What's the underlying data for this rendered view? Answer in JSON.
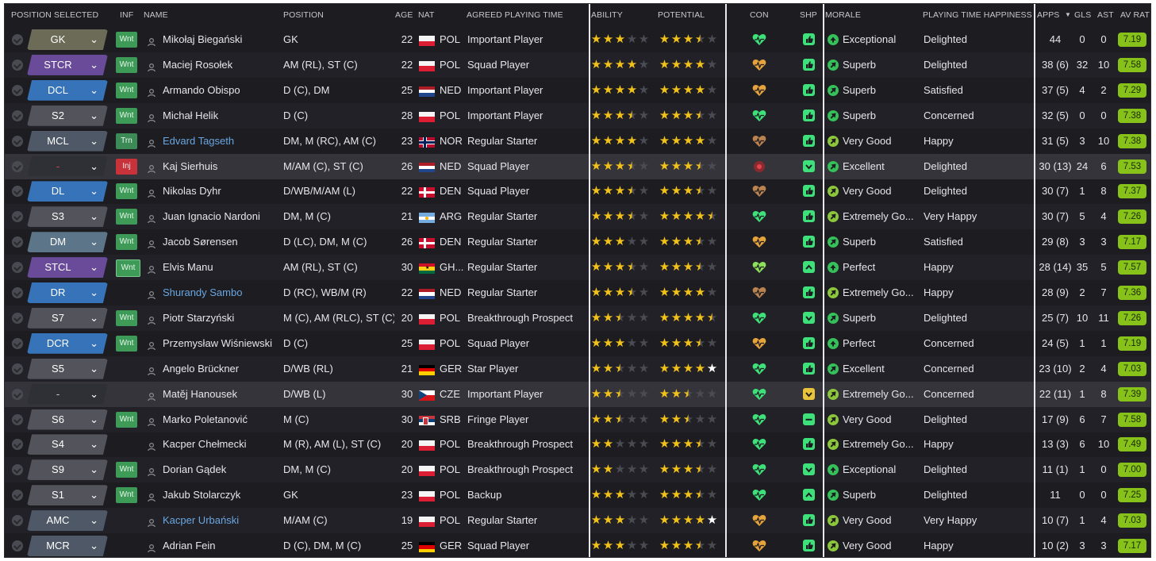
{
  "headers": {
    "position_selected": "POSITION SELECTED",
    "inf": "INF",
    "name": "NAME",
    "position": "POSITION",
    "age": "AGE",
    "nat": "NAT",
    "agreed_playing_time": "AGREED PLAYING TIME",
    "ability": "ABILITY",
    "potential": "POTENTIAL",
    "con": "CON",
    "shp": "SHP",
    "morale": "MORALE",
    "playing_time_happiness": "PLAYING TIME HAPPINESS",
    "apps": "APPS",
    "gls": "GLS",
    "ast": "AST",
    "av_rat": "AV RAT",
    "sort_indicator": "▼"
  },
  "colors": {
    "star_full": "#f2c21a",
    "star_empty": "#4b4b53",
    "rating_bg": "#86c219",
    "con_green": "#3ee07a",
    "con_orange": "#e6a33c",
    "shp_green": "#3ee07a",
    "shp_yellow": "#e8c23a",
    "wanted_badge": "#3d9a57",
    "injured_badge": "#c8333b"
  },
  "players": [
    {
      "sel": "GK",
      "selstyle": "gk",
      "inf": "Wnt",
      "name": "Mikołaj Biegański",
      "link": false,
      "position": "GK",
      "age": "22",
      "nat": "POL",
      "flag": "pol",
      "apt": "Important Player",
      "ability": 3,
      "potential": 3.5,
      "con": "green",
      "shp": "thumb-green",
      "morale": "Exceptional",
      "mdir": "up",
      "mcolor": "#35c05a",
      "pth": "Delighted",
      "apps": "44",
      "gls": "0",
      "ast": "0",
      "rat": "7.19"
    },
    {
      "sel": "STCR",
      "selstyle": "str",
      "inf": "Wnt",
      "name": "Maciej Rosołek",
      "link": false,
      "position": "AM (RL), ST (C)",
      "age": "22",
      "nat": "POL",
      "flag": "pol",
      "apt": "Squad Player",
      "ability": 4,
      "potential": 4,
      "con": "orange",
      "shp": "thumb-green",
      "morale": "Superb",
      "mdir": "up-right",
      "mcolor": "#35c05a",
      "pth": "Delighted",
      "apps": "38 (6)",
      "gls": "32",
      "ast": "10",
      "rat": "7.58"
    },
    {
      "sel": "DCL",
      "selstyle": "def",
      "inf": "Wnt",
      "name": "Armando Obispo",
      "link": false,
      "position": "D (C), DM",
      "age": "25",
      "nat": "NED",
      "flag": "ned",
      "apt": "Important Player",
      "ability": 4,
      "potential": 4,
      "con": "orange",
      "shp": "thumb-green",
      "morale": "Superb",
      "mdir": "up-right",
      "mcolor": "#35c05a",
      "pth": "Satisfied",
      "apps": "37 (5)",
      "gls": "4",
      "ast": "2",
      "rat": "7.29"
    },
    {
      "sel": "S2",
      "selstyle": "sub",
      "inf": "Wnt",
      "name": "Michał Helik",
      "link": false,
      "position": "D (C)",
      "age": "28",
      "nat": "POL",
      "flag": "pol",
      "apt": "Important Player",
      "ability": 3.5,
      "potential": 3.5,
      "con": "green",
      "shp": "thumb-green",
      "morale": "Superb",
      "mdir": "up-right",
      "mcolor": "#35c05a",
      "pth": "Concerned",
      "apps": "32 (5)",
      "gls": "0",
      "ast": "0",
      "rat": "7.38"
    },
    {
      "sel": "MCL",
      "selstyle": "mid",
      "inf": "Trn",
      "name": "Edvard Tagseth",
      "link": true,
      "position": "DM, M (RC), AM (C)",
      "age": "23",
      "nat": "NOR",
      "flag": "nor",
      "apt": "Regular Starter",
      "ability": 4,
      "potential": 4,
      "con": "brown",
      "shp": "thumb-green",
      "morale": "Very Good",
      "mdir": "up-right",
      "mcolor": "#8cc63a",
      "pth": "Happy",
      "apps": "31 (5)",
      "gls": "3",
      "ast": "10",
      "rat": "7.38"
    },
    {
      "sel": "-",
      "selstyle": "none red",
      "inf": "Inj",
      "name": "Kaj Sierhuis",
      "link": false,
      "position": "M/AM (C), ST (C)",
      "age": "26",
      "nat": "NED",
      "flag": "ned",
      "apt": "Squad Player",
      "ability": 3.5,
      "potential": 3.5,
      "con": "injury",
      "shp": "chev-green",
      "morale": "Excellent",
      "mdir": "up-right",
      "mcolor": "#35c05a",
      "pth": "Delighted",
      "apps": "30 (13)",
      "gls": "24",
      "ast": "6",
      "rat": "7.53"
    },
    {
      "sel": "DL",
      "selstyle": "def",
      "inf": "Wnt",
      "name": "Nikolas Dyhr",
      "link": false,
      "position": "D/WB/M/AM (L)",
      "age": "22",
      "nat": "DEN",
      "flag": "den",
      "apt": "Squad Player",
      "ability": 3.5,
      "potential": 3.5,
      "con": "brown",
      "shp": "thumb-green",
      "morale": "Very Good",
      "mdir": "up-right",
      "mcolor": "#8cc63a",
      "pth": "Delighted",
      "apps": "30 (7)",
      "gls": "1",
      "ast": "8",
      "rat": "7.37"
    },
    {
      "sel": "S3",
      "selstyle": "sub",
      "inf": "Wnt",
      "name": "Juan Ignacio Nardoni",
      "link": false,
      "position": "DM, M (C)",
      "age": "21",
      "nat": "ARG",
      "flag": "arg",
      "apt": "Regular Starter",
      "ability": 3.5,
      "potential": 4.5,
      "con": "green",
      "shp": "thumb-green",
      "morale": "Extremely Go...",
      "mdir": "up-right",
      "mcolor": "#8cc63a",
      "pth": "Very Happy",
      "apps": "30 (7)",
      "gls": "5",
      "ast": "4",
      "rat": "7.26"
    },
    {
      "sel": "DM",
      "selstyle": "dm",
      "inf": "Wnt",
      "name": "Jacob Sørensen",
      "link": false,
      "position": "D (LC), DM, M (C)",
      "age": "26",
      "nat": "DEN",
      "flag": "den",
      "apt": "Regular Starter",
      "ability": 3,
      "potential": 3.5,
      "con": "orange",
      "shp": "thumb-green",
      "morale": "Superb",
      "mdir": "up-right",
      "mcolor": "#35c05a",
      "pth": "Satisfied",
      "apps": "29 (8)",
      "gls": "3",
      "ast": "3",
      "rat": "7.17"
    },
    {
      "sel": "STCL",
      "selstyle": "str",
      "inf": "Wnt",
      "name": "Elvis Manu",
      "link": false,
      "position": "AM (RL), ST (C)",
      "age": "30",
      "nat": "GH...",
      "flag": "gha",
      "apt": "Regular Starter",
      "ability": 3.5,
      "potential": 3.5,
      "con": "lime",
      "shp": "chev-up-green",
      "morale": "Perfect",
      "mdir": "up",
      "mcolor": "#35c05a",
      "pth": "Happy",
      "apps": "28 (14)",
      "gls": "35",
      "ast": "5",
      "rat": "7.57"
    },
    {
      "sel": "DR",
      "selstyle": "def",
      "inf": "",
      "name": "Shurandy Sambo",
      "link": true,
      "position": "D (RC), WB/M (R)",
      "age": "22",
      "nat": "NED",
      "flag": "ned",
      "apt": "Regular Starter",
      "ability": 3.5,
      "potential": 4,
      "con": "brown",
      "shp": "thumb-green",
      "morale": "Extremely Go...",
      "mdir": "up-right",
      "mcolor": "#8cc63a",
      "pth": "Happy",
      "apps": "28 (9)",
      "gls": "2",
      "ast": "7",
      "rat": "7.36"
    },
    {
      "sel": "S7",
      "selstyle": "sub",
      "inf": "Wnt",
      "name": "Piotr Starzyński",
      "link": false,
      "position": "M (C), AM (RLC), ST (C)",
      "age": "20",
      "nat": "POL",
      "flag": "pol",
      "apt": "Breakthrough Prospect",
      "ability": 2.5,
      "potential": 4.5,
      "con": "green",
      "shp": "chev-green",
      "morale": "Superb",
      "mdir": "up-right",
      "mcolor": "#35c05a",
      "pth": "Delighted",
      "apps": "25 (7)",
      "gls": "10",
      "ast": "11",
      "rat": "7.26"
    },
    {
      "sel": "DCR",
      "selstyle": "def",
      "inf": "Wnt",
      "name": "Przemysław Wiśniewski",
      "link": false,
      "position": "D (C)",
      "age": "25",
      "nat": "POL",
      "flag": "pol",
      "apt": "Squad Player",
      "ability": 3,
      "potential": 3.5,
      "con": "orange",
      "shp": "thumb-green",
      "morale": "Perfect",
      "mdir": "up",
      "mcolor": "#35c05a",
      "pth": "Concerned",
      "apps": "24 (5)",
      "gls": "1",
      "ast": "1",
      "rat": "7.19"
    },
    {
      "sel": "S5",
      "selstyle": "sub",
      "inf": "",
      "name": "Angelo Brückner",
      "link": false,
      "position": "D/WB (RL)",
      "age": "21",
      "nat": "GER",
      "flag": "ger",
      "apt": "Star Player",
      "ability": 2.5,
      "potential": 4,
      "potwhite": true,
      "con": "green",
      "shp": "thumb-green",
      "morale": "Excellent",
      "mdir": "up-right",
      "mcolor": "#35c05a",
      "pth": "Concerned",
      "apps": "23 (10)",
      "gls": "2",
      "ast": "4",
      "rat": "7.03"
    },
    {
      "sel": "-",
      "selstyle": "none",
      "inf": "",
      "name": "Matěj Hanousek",
      "link": false,
      "position": "D/WB (L)",
      "age": "30",
      "nat": "CZE",
      "flag": "cze",
      "apt": "Important Player",
      "ability": 2.5,
      "potential": 2.5,
      "con": "green",
      "shp": "chev-yellow",
      "morale": "Extremely Go...",
      "mdir": "up-right",
      "mcolor": "#8cc63a",
      "pth": "Concerned",
      "apps": "22 (11)",
      "gls": "1",
      "ast": "8",
      "rat": "7.39"
    },
    {
      "sel": "S6",
      "selstyle": "sub",
      "inf": "Wnt",
      "name": "Marko Poletanović",
      "link": false,
      "position": "M (C)",
      "age": "30",
      "nat": "SRB",
      "flag": "srb",
      "apt": "Fringe Player",
      "ability": 2.5,
      "potential": 2.5,
      "con": "green",
      "shp": "minus-green",
      "morale": "Very Good",
      "mdir": "up-right",
      "mcolor": "#8cc63a",
      "pth": "Delighted",
      "apps": "17 (9)",
      "gls": "6",
      "ast": "7",
      "rat": "7.58"
    },
    {
      "sel": "S4",
      "selstyle": "sub",
      "inf": "",
      "name": "Kacper Chełmecki",
      "link": false,
      "position": "M (R), AM (L), ST (C)",
      "age": "20",
      "nat": "POL",
      "flag": "pol",
      "apt": "Breakthrough Prospect",
      "ability": 2,
      "potential": 3.5,
      "con": "green",
      "shp": "thumb-green",
      "morale": "Extremely Go...",
      "mdir": "up-right",
      "mcolor": "#8cc63a",
      "pth": "Happy",
      "apps": "13 (3)",
      "gls": "6",
      "ast": "10",
      "rat": "7.49"
    },
    {
      "sel": "S9",
      "selstyle": "sub",
      "inf": "Wnt",
      "name": "Dorian Gądek",
      "link": false,
      "position": "DM, M (C)",
      "age": "20",
      "nat": "POL",
      "flag": "pol",
      "apt": "Breakthrough Prospect",
      "ability": 2,
      "potential": 3.5,
      "con": "green",
      "shp": "chev-green",
      "morale": "Exceptional",
      "mdir": "up",
      "mcolor": "#35c05a",
      "pth": "Delighted",
      "apps": "11 (1)",
      "gls": "1",
      "ast": "0",
      "rat": "7.00"
    },
    {
      "sel": "S1",
      "selstyle": "sub",
      "inf": "Wnt",
      "name": "Jakub Stolarczyk",
      "link": false,
      "position": "GK",
      "age": "23",
      "nat": "POL",
      "flag": "pol",
      "apt": "Backup",
      "ability": 3,
      "potential": 3.5,
      "con": "green",
      "shp": "chev-up-green",
      "morale": "Superb",
      "mdir": "up-right",
      "mcolor": "#35c05a",
      "pth": "Delighted",
      "apps": "11",
      "gls": "0",
      "ast": "0",
      "rat": "7.25"
    },
    {
      "sel": "AMC",
      "selstyle": "mid",
      "inf": "",
      "name": "Kacper Urbański",
      "link": true,
      "position": "M/AM (C)",
      "age": "19",
      "nat": "POL",
      "flag": "pol",
      "apt": "Regular Starter",
      "ability": 3,
      "potential": 5,
      "potwhite": true,
      "con": "orange",
      "shp": "thumb-green",
      "morale": "Very Good",
      "mdir": "up-right",
      "mcolor": "#8cc63a",
      "pth": "Very Happy",
      "apps": "10 (7)",
      "gls": "1",
      "ast": "4",
      "rat": "7.03"
    },
    {
      "sel": "MCR",
      "selstyle": "mid",
      "inf": "",
      "name": "Adrian Fein",
      "link": false,
      "position": "D (C), DM, M (C)",
      "age": "25",
      "nat": "GER",
      "flag": "ger",
      "apt": "Squad Player",
      "ability": 3,
      "potential": 3.5,
      "con": "orange",
      "shp": "thumb-green",
      "morale": "Very Good",
      "mdir": "up-right",
      "mcolor": "#8cc63a",
      "pth": "Happy",
      "apps": "10 (2)",
      "gls": "3",
      "ast": "3",
      "rat": "7.17"
    }
  ]
}
